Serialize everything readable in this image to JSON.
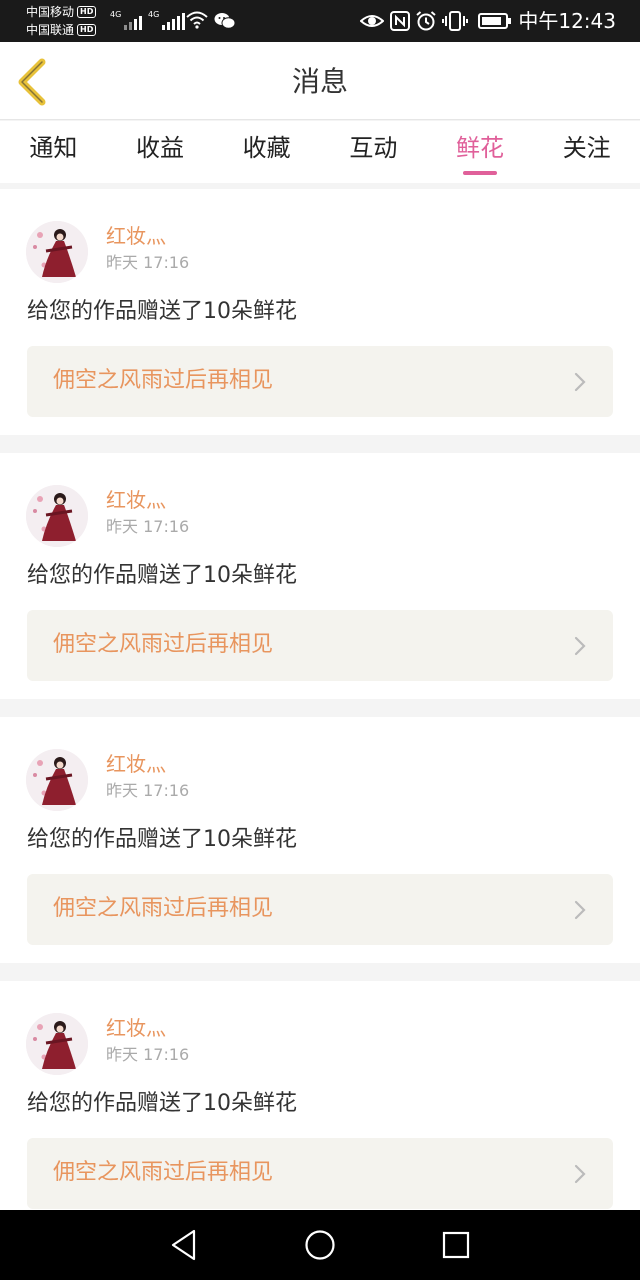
{
  "status_bar": {
    "carrier_1": "中国移动",
    "carrier_2": "中国联通",
    "hd_badge": "HD",
    "network_1": "4G",
    "network_2": "4G",
    "time": "中午12:43",
    "icons": [
      "signal-icon",
      "wifi-icon",
      "wechat-icon",
      "eye-icon",
      "nfc-icon",
      "alarm-icon",
      "vibrate-icon",
      "battery-icon"
    ]
  },
  "header": {
    "title": "消息",
    "back_icon": "chevron-left-icon"
  },
  "tabs": [
    {
      "label": "通知",
      "active": false
    },
    {
      "label": "收益",
      "active": false
    },
    {
      "label": "收藏",
      "active": false
    },
    {
      "label": "互动",
      "active": false
    },
    {
      "label": "鲜花",
      "active": true
    },
    {
      "label": "关注",
      "active": false
    }
  ],
  "notifications": [
    {
      "username": "红妆灬",
      "time": "昨天 17:16",
      "message": "给您的作品赠送了10朵鲜花",
      "work_title": "佣空之风雨过后再相见"
    },
    {
      "username": "红妆灬",
      "time": "昨天 17:16",
      "message": "给您的作品赠送了10朵鲜花",
      "work_title": "佣空之风雨过后再相见"
    },
    {
      "username": "红妆灬",
      "time": "昨天 17:16",
      "message": "给您的作品赠送了10朵鲜花",
      "work_title": "佣空之风雨过后再相见"
    },
    {
      "username": "红妆灬",
      "time": "昨天 17:16",
      "message": "给您的作品赠送了10朵鲜花",
      "work_title": "佣空之风雨过后再相见"
    }
  ],
  "colors": {
    "accent": "#e0609a",
    "orange": "#e8955e",
    "back_arrow": "#e8c23a"
  },
  "nav_bar": {
    "icons": [
      "nav-back-icon",
      "nav-home-icon",
      "nav-recent-icon"
    ]
  }
}
